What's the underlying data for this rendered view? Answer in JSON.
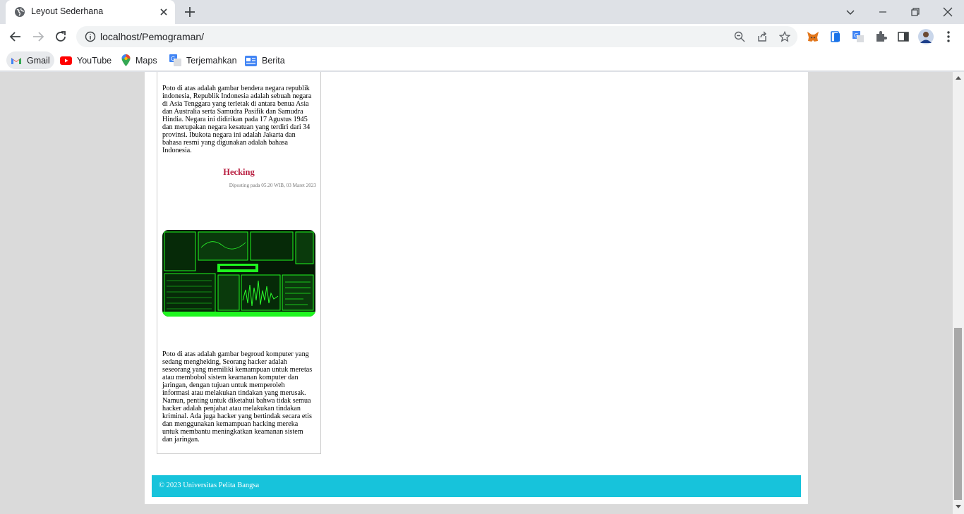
{
  "browser": {
    "tab_title": "Leyout Sederhana",
    "url": "localhost/Pemograman/",
    "bookmarks": [
      {
        "label": "Gmail",
        "icon": "gmail-icon"
      },
      {
        "label": "YouTube",
        "icon": "youtube-icon"
      },
      {
        "label": "Maps",
        "icon": "maps-icon"
      },
      {
        "label": "Terjemahkan",
        "icon": "translate-icon"
      },
      {
        "label": "Berita",
        "icon": "news-icon"
      }
    ]
  },
  "page": {
    "para1": "Poto di atas adalah gambar bendera negara republik indonesia, Republik Indonesia adalah sebuah negara di Asia Tenggara yang terletak di antara benua Asia dan Australia serta Samudra Pasifik dan Samudra Hindia. Negara ini didirikan pada 17 Agustus 1945 dan merupakan negara kesatuan yang terdiri dari 34 provinsi. Ibukota negara ini adalah Jakarta dan bahasa resmi yang digunakan adalah bahasa Indonesia.",
    "article_title": "Hecking",
    "article_date": "Diposting pada 05.20 WIB, 03 Maret 2023",
    "para2": "Poto di atas adalah gambar begroud komputer yang sedang mengheking, Seorang hacker adalah seseorang yang memiliki kemampuan untuk meretas atau membobol sistem keamanan komputer dan jaringan, dengan tujuan untuk memperoleh informasi atau melakukan tindakan yang merusak. Namun, penting untuk diketahui bahwa tidak semua hacker adalah penjahat atau melakukan tindakan kriminal. Ada juga hacker yang bertindak secara etis dan menggunakan kemampuan hacking mereka untuk membantu meningkatkan keamanan sistem dan jaringan.",
    "footer": "© 2023 Universitas Pelita Bangsa"
  },
  "colors": {
    "article_title": "#b81c3e",
    "footer_bg": "#17c3db"
  }
}
